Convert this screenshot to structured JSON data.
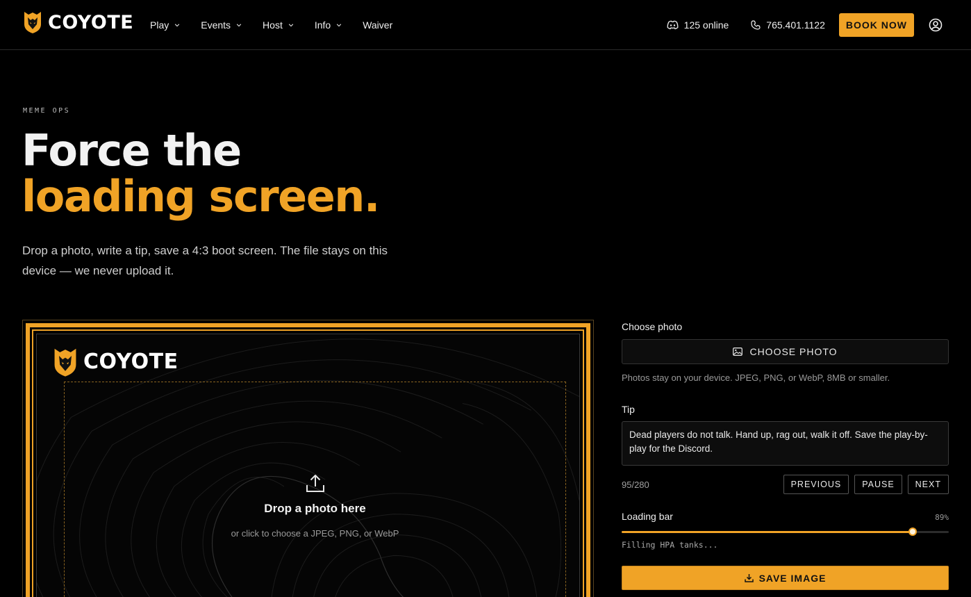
{
  "brand": {
    "name": "COYOTE",
    "accent": "#f0a326",
    "logo_icon": "coyote-shield-icon"
  },
  "nav": {
    "items": [
      {
        "label": "Play",
        "dropdown": true
      },
      {
        "label": "Events",
        "dropdown": true
      },
      {
        "label": "Host",
        "dropdown": true
      },
      {
        "label": "Info",
        "dropdown": true
      },
      {
        "label": "Waiver",
        "dropdown": false
      }
    ]
  },
  "header": {
    "online": "125 online",
    "online_icon": "discord-icon",
    "phone": "765.401.1122",
    "phone_icon": "phone-icon",
    "book_label": "BOOK NOW",
    "account_icon": "account-icon"
  },
  "hero": {
    "eyebrow": "MEME OPS",
    "headline_line1": "Force the",
    "headline_line2": "loading screen.",
    "lede": "Drop a photo, write a tip, save a 4:3 boot screen. The file stays on this device — we never upload it."
  },
  "preview": {
    "brand": "COYOTE",
    "drop_title": "Drop a photo here",
    "drop_sub": "or click to choose a JPEG, PNG, or WebP",
    "upload_icon": "upload-icon"
  },
  "controls": {
    "choose_label": "Choose photo",
    "choose_button": "CHOOSE PHOTO",
    "choose_icon": "image-icon",
    "choose_hint": "Photos stay on your device. JPEG, PNG, or WebP, 8MB or smaller.",
    "tip_label": "Tip",
    "tip_text": "Dead players do not talk. Hand up, rag out, walk it off. Save the play-by-play for the Discord.",
    "tip_counter": "95/280",
    "prev_label": "PREVIOUS",
    "pause_label": "PAUSE",
    "next_label": "NEXT",
    "loading_label": "Loading bar",
    "loading_pct_text": "89%",
    "loading_value": 89,
    "loading_status": "Filling HPA tanks...",
    "save_label": "SAVE IMAGE",
    "save_icon": "download-icon"
  }
}
